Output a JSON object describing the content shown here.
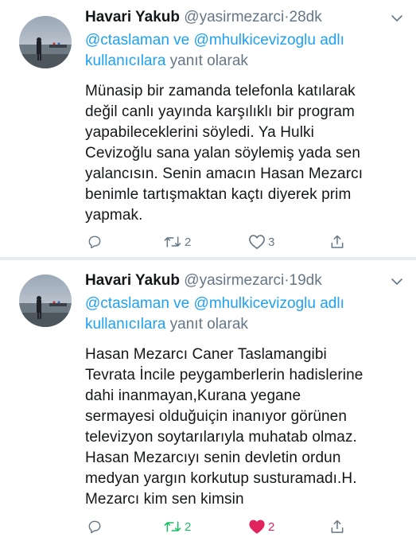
{
  "colors": {
    "text": "#14171a",
    "secondary": "#657786",
    "mention": "#1da1f2",
    "retweet_active": "#17bf63",
    "like_active": "#e0245e",
    "divider": "#e6ecf0"
  },
  "tweets": [
    {
      "author_name": "Havari Yakub",
      "handle": "@yasirmezarci",
      "separator": "·",
      "time": "28dk",
      "reply_mention_1": "@ctaslaman",
      "reply_and": "ve",
      "reply_mention_2": "@mhulkicevizoglu",
      "reply_mention_3": "adlı kullanıcılara",
      "reply_suffix": "yanıt olarak",
      "body_lines": [
        "Münasip bir zamanda telefonla katılarak",
        "değil canlı yayında karşılıklı bir program",
        "yapabileceklerini söyledi. Ya Hulki",
        "Cevizoğlu sana yalan söylemiş yada sen",
        "yalancısın. Senin amacın Hasan Mezarcı",
        "benimle tartışmaktan kaçtı diyerek prim",
        "yapmak."
      ],
      "reply_icon": "reply-icon",
      "retweet_icon": "retweet-icon",
      "retweet_count": "2",
      "retweet_active": false,
      "like_icon": "heart-outline-icon",
      "like_count": "3",
      "like_active": false,
      "share_icon": "share-icon"
    },
    {
      "author_name": "Havari Yakub",
      "handle": "@yasirmezarci",
      "separator": "·",
      "time": "19dk",
      "reply_mention_1": "@ctaslaman",
      "reply_and": "ve",
      "reply_mention_2": "@mhulkicevizoglu",
      "reply_mention_3": "adlı kullanıcılara",
      "reply_suffix": "yanıt olarak",
      "body_lines": [
        "Hasan Mezarcı Caner Taslamangibi",
        "Tevrata İncile peygamberlerin hadislerine",
        "dahi inanmayan,Kurana yegane",
        "sermayesi olduğuiçin inanıyor görünen",
        "televizyon soytarılarıyla muhatab olmaz.",
        "Hasan Mezarcıyı senin devletin ordun",
        "medyan yargın korkutup susturamadı.H.",
        "Mezarcı kim sen kimsin"
      ],
      "reply_icon": "reply-icon",
      "retweet_icon": "retweet-icon",
      "retweet_count": "2",
      "retweet_active": true,
      "like_icon": "heart-filled-icon",
      "like_count": "2",
      "like_active": true,
      "share_icon": "share-icon"
    }
  ]
}
